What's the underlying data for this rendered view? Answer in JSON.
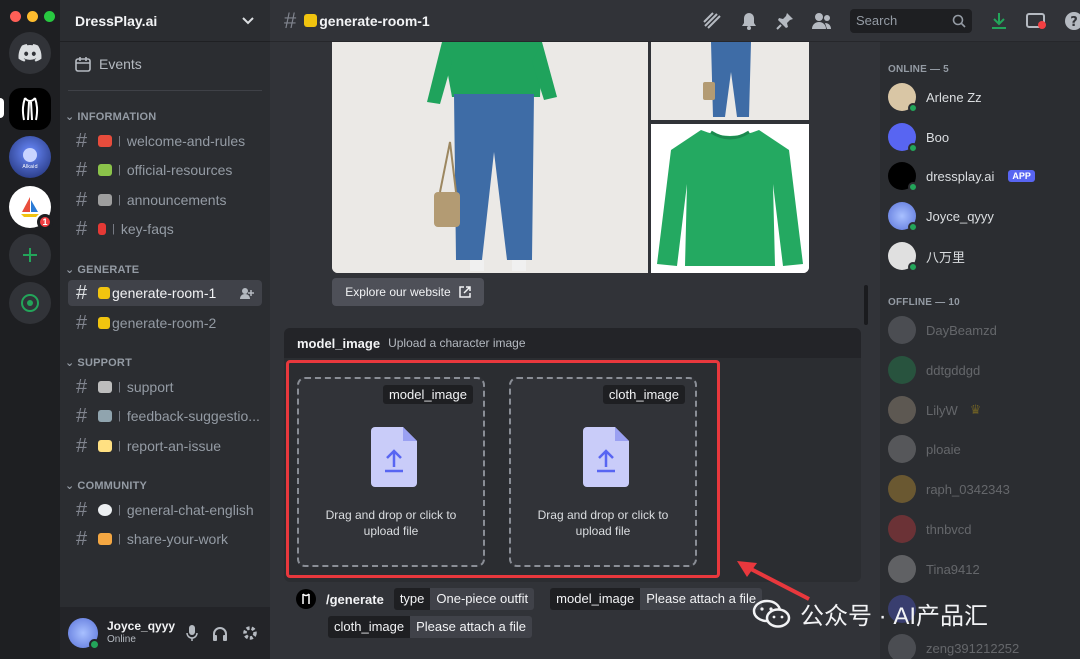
{
  "guild": {
    "name": "DressPlay.ai"
  },
  "events_label": "Events",
  "categories": {
    "information": "INFORMATION",
    "generate": "GENERATE",
    "support": "SUPPORT",
    "community": "COMMUNITY"
  },
  "channels": {
    "welcome": "welcome-and-rules",
    "resources": "official-resources",
    "announcements": "announcements",
    "faqs": "key-faqs",
    "room1": "generate-room-1",
    "room2": "generate-room-2",
    "support": "support",
    "feedback": "feedback-suggestio...",
    "report": "report-an-issue",
    "general": "general-chat-english",
    "share": "share-your-work"
  },
  "header": {
    "channel": "generate-room-1",
    "search_placeholder": "Search"
  },
  "current_user": {
    "name": "Joyce_qyyy",
    "status": "Online"
  },
  "server_badge": "1",
  "main": {
    "explore_button": "Explore our website",
    "option_name": "model_image",
    "option_desc": "Upload a character image",
    "drop1_tag": "model_image",
    "drop2_tag": "cloth_image",
    "drop_text": "Drag and drop or click to upload file",
    "command": "/generate",
    "chips": [
      {
        "k": "type",
        "v": "One-piece outfit"
      },
      {
        "k": "model_image",
        "v": "Please attach a file"
      },
      {
        "k": "cloth_image",
        "v": "Please attach a file"
      }
    ]
  },
  "members": {
    "online_header": "ONLINE — 5",
    "offline_header": "OFFLINE — 10",
    "online": [
      "Arlene Zz",
      "Boo",
      "dressplay.ai",
      "Joyce_qyyy",
      "八万里"
    ],
    "app_tag": "APP",
    "offline": [
      "DayBeamzd",
      "ddtgddgd",
      "LilyW",
      "ploaie",
      "raph_0342343",
      "thnbvcd",
      "Tina9412",
      "",
      "zeng391212252"
    ]
  },
  "watermark": {
    "text": "公众号 · AI产品汇"
  },
  "colors": {
    "accent": "#5865f2",
    "online": "#23a55a",
    "highlight": "#e8383d"
  }
}
